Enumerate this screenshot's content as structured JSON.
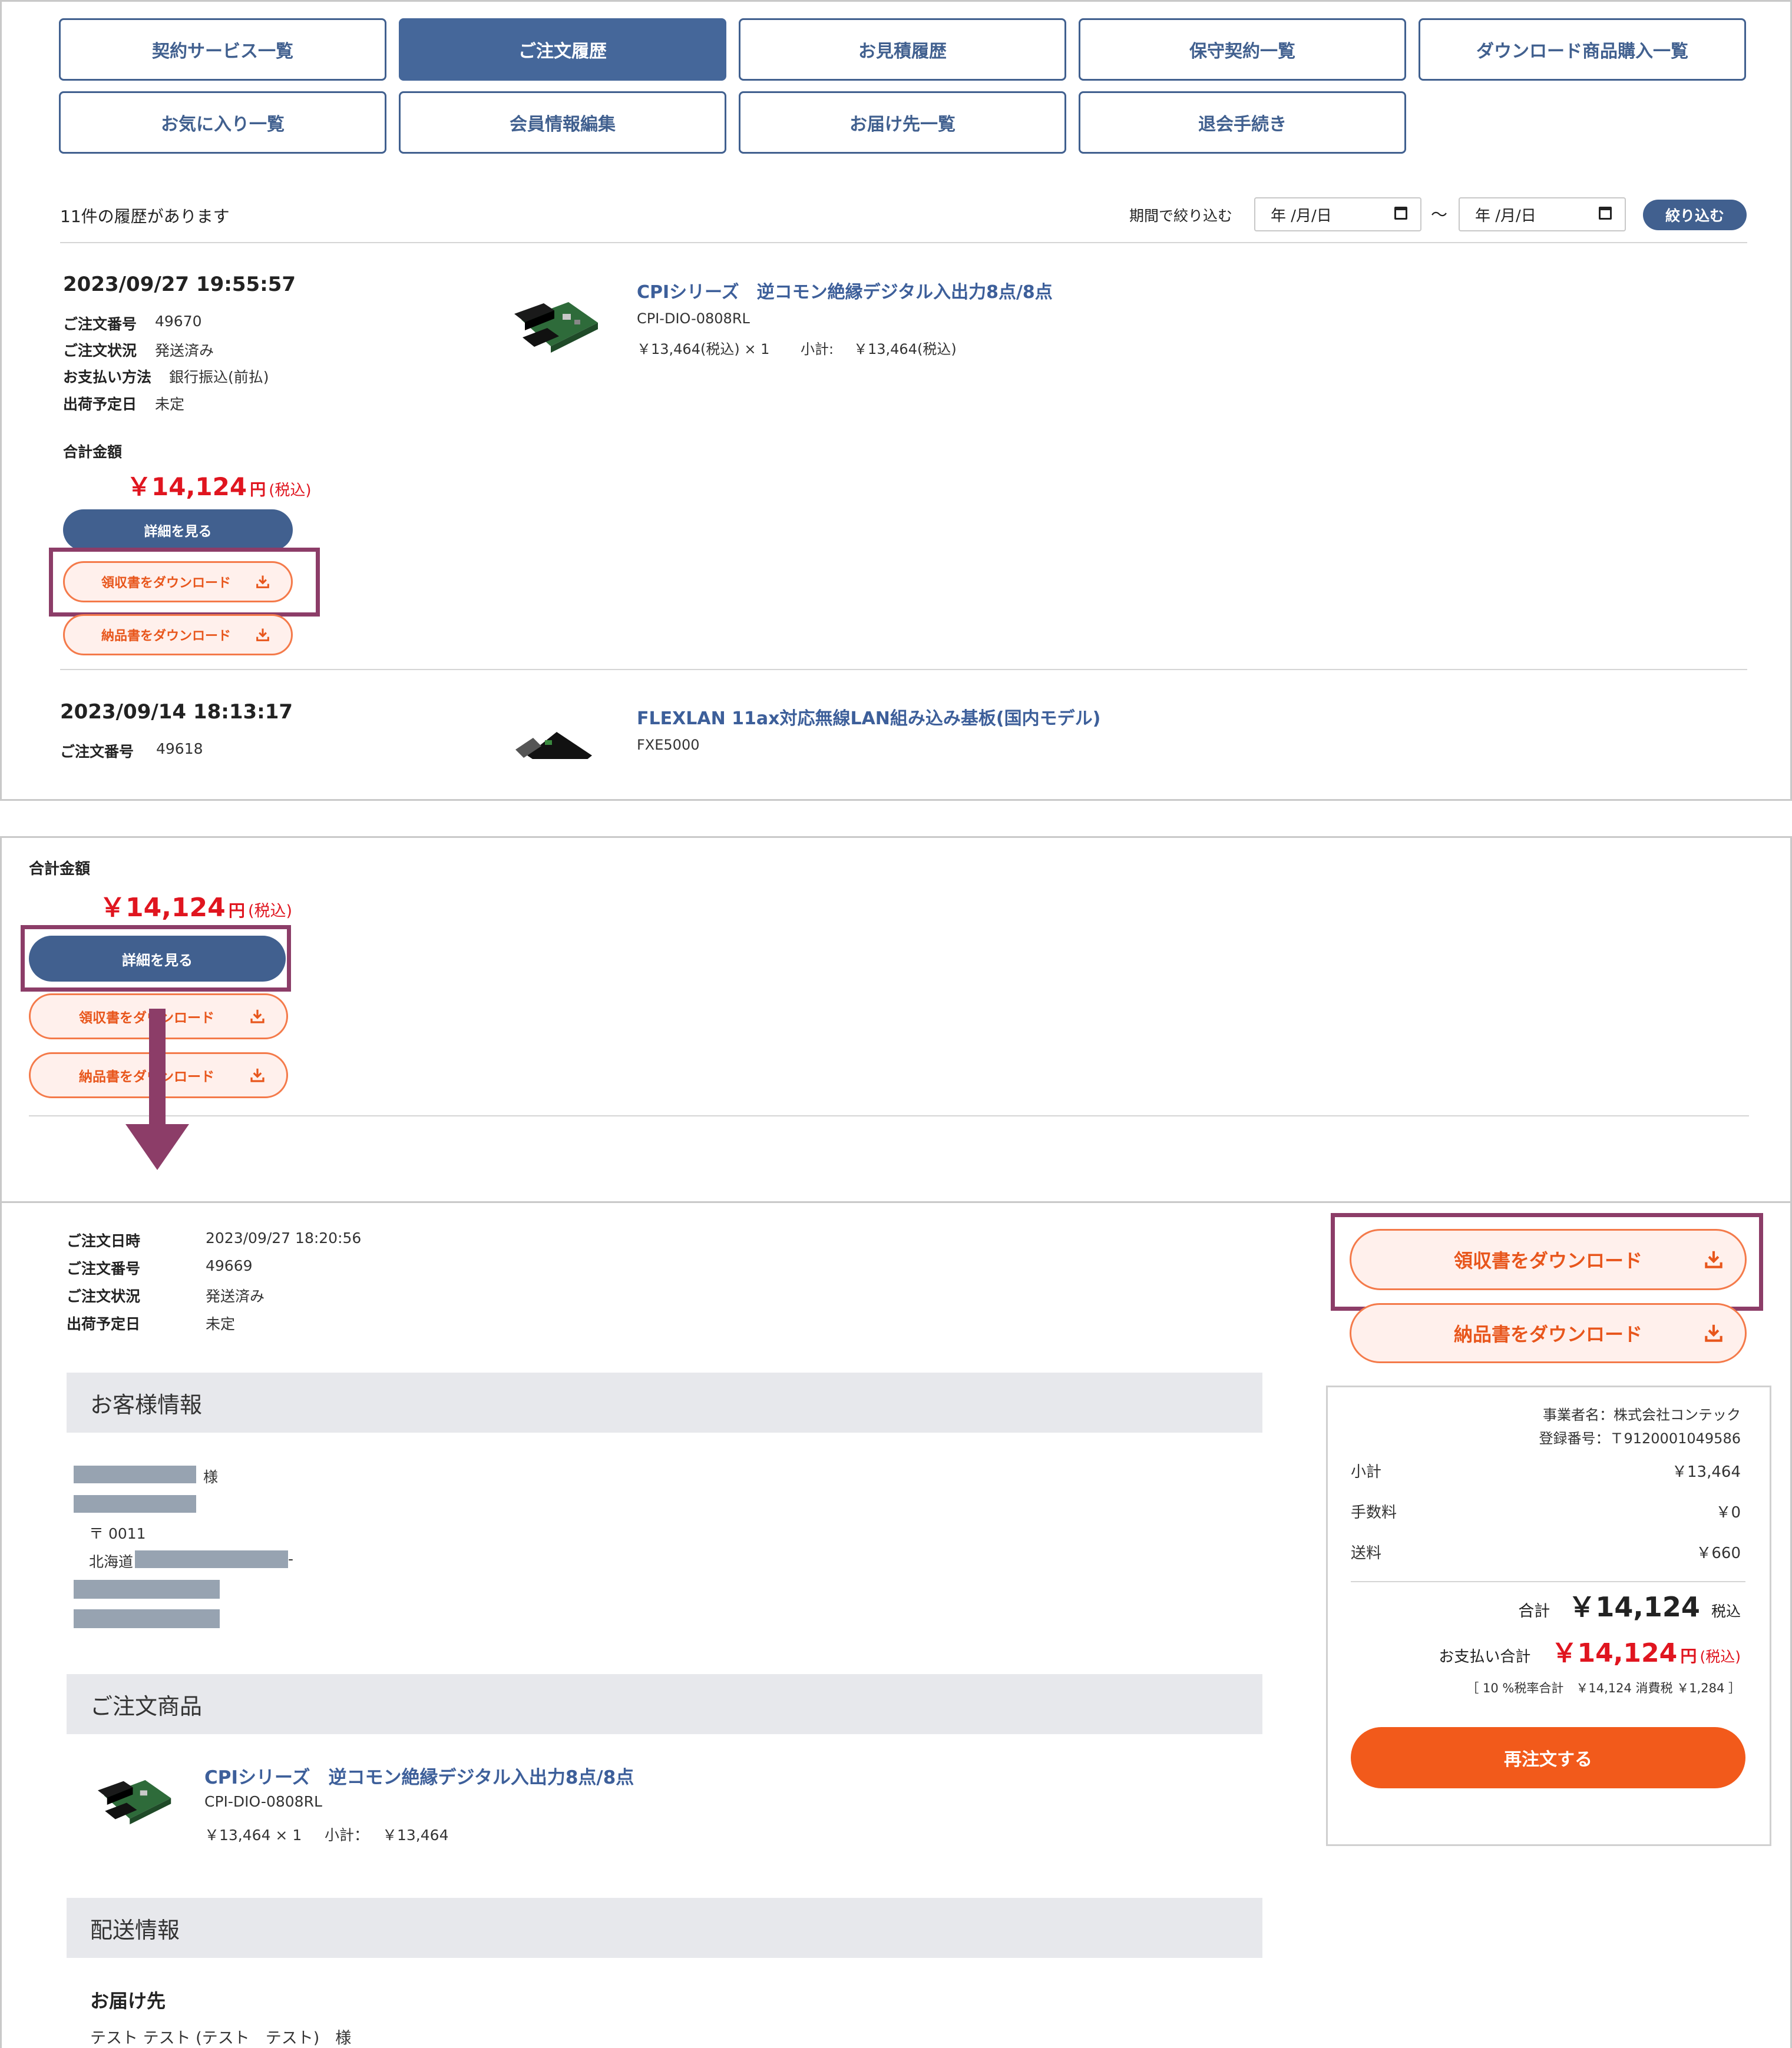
{
  "nav": {
    "row1": [
      "契約サービス一覧",
      "ご注文履歴",
      "お見積履歴",
      "保守契約一覧",
      "ダウンロード商品購入一覧"
    ],
    "row2": [
      "お気に入り一覧",
      "会員情報編集",
      "お届け先一覧",
      "退会手続き"
    ]
  },
  "list": {
    "count_text": "11件の履歴があります",
    "filter_label": "期間で絞り込む",
    "date_from_placeholder": "年 /月/日",
    "date_to_placeholder": "年 /月/日",
    "tilde": "〜",
    "filter_button": "絞り込む"
  },
  "labels": {
    "order_no": "ご注文番号",
    "order_status": "ご注文状況",
    "payment_method": "お支払い方法",
    "ship_date": "出荷予定日",
    "total_amount": "合計金額",
    "yen_unit": "円",
    "tax_incl": "(税込)",
    "detail_button": "詳細を見る",
    "receipt_button": "領収書をダウンロード",
    "delivery_button": "納品書をダウンロード",
    "subtotal_label": "小計:"
  },
  "order1": {
    "datetime": "2023/09/27 19:55:57",
    "order_no": "49670",
    "status": "発送済み",
    "payment": "銀行振込(前払)",
    "ship_date": "未定",
    "total": "￥14,124",
    "product_name": "CPIシリーズ　逆コモン絶縁デジタル入出力8点/8点",
    "product_code": "CPI-DIO-0808RL",
    "product_price": "￥13,464(税込) × 1",
    "product_subtotal": "￥13,464(税込)"
  },
  "order2": {
    "datetime": "2023/09/14 18:13:17",
    "order_no": "49618",
    "product_name": "FLEXLAN 11ax対応無線LAN組み込み基板(国内モデル)",
    "product_code": "FXE5000"
  },
  "zoom": {
    "total_label": "合計金額",
    "total": "￥14,124"
  },
  "detail": {
    "labels": {
      "order_datetime": "ご注文日時",
      "order_no": "ご注文番号",
      "order_status": "ご注文状況",
      "ship_date": "出荷予定日"
    },
    "order_datetime": "2023/09/27 18:20:56",
    "order_no": "49669",
    "order_status": "発送済み",
    "ship_date": "未定",
    "customer_section": "お客様情報",
    "customer_honorific": "様",
    "postal": "〒  0011",
    "address_prefix": "北海道",
    "address_suffix": "-",
    "items_section": "ご注文商品",
    "item_name": "CPIシリーズ　逆コモン絶縁デジタル入出力8点/8点",
    "item_code": "CPI-DIO-0808RL",
    "item_price": "￥13,464 × 1",
    "item_subtotal_label": "小計：",
    "item_subtotal": "￥13,464",
    "delivery_section": "配送情報",
    "ship_to_heading": "お届け先",
    "ship_to_name": "テスト テスト (テスト　テスト)　様",
    "receipt_button": "領収書をダウンロード",
    "delivery_button": "納品書をダウンロード",
    "summary": {
      "company": "事業者名：株式会社コンテック",
      "reg_no": "登録番号：Ｔ9120001049586",
      "subtotal_label": "小計",
      "subtotal": "￥13,464",
      "fee_label": "手数料",
      "fee": "￥0",
      "shipping_label": "送料",
      "shipping": "￥660",
      "total_label": "合計",
      "total": "￥14,124",
      "total_tax": "税込",
      "pay_total_label": "お支払い合計",
      "pay_total": "￥14,124",
      "pay_yen": "円",
      "pay_tax": "(税込)",
      "tax_note": "［ 10 %税率合計　￥14,124 消費税 ￥1,284 ］",
      "reorder_button": "再注文する"
    }
  },
  "colors": {
    "brand_blue": "#41608f",
    "highlight": "#8c3d68",
    "orange": "#f25a1b",
    "price_red": "#e0151f"
  }
}
